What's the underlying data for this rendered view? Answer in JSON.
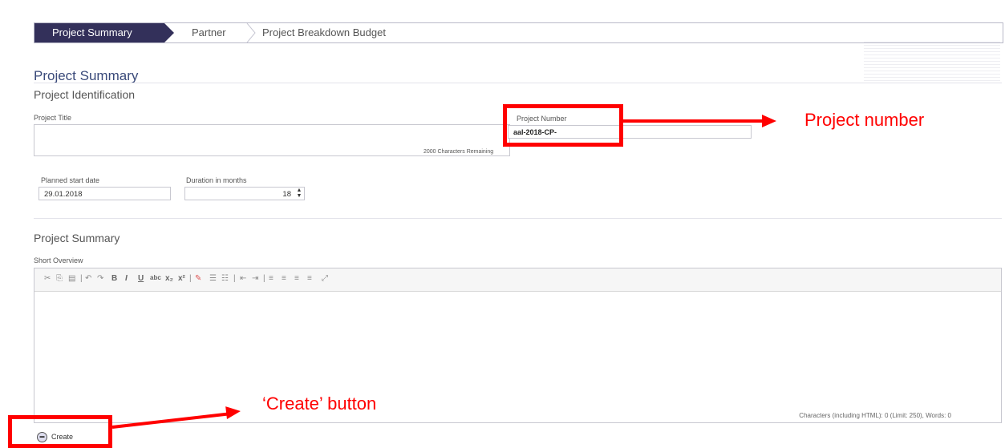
{
  "wizard": {
    "steps": [
      "Project Summary",
      "Partner",
      "Project Breakdown Budget"
    ]
  },
  "section": {
    "title": "Project Summary",
    "subtitle": "Project Identification"
  },
  "form": {
    "project_title_label": "Project Title",
    "project_title_value": "",
    "chars_remaining": "2000 Characters Remaining",
    "project_number_label": "Project Number",
    "project_number_value": "aal-2018-CP-",
    "start_date_label": "Planned start date",
    "start_date_value": "29.01.2018",
    "duration_label": "Duration in months",
    "duration_value": "18"
  },
  "summary": {
    "title": "Project Summary",
    "short_overview_label": "Short Overview",
    "char_count": "Characters (including HTML): 0 (Limit: 250), Words: 0"
  },
  "toolbar": {
    "buttons": [
      "cut-icon",
      "copy-icon",
      "paste-text-icon",
      "undo-icon",
      "redo-icon",
      "bold-icon",
      "italic-icon",
      "underline-icon",
      "strikethrough-icon",
      "subscript-icon",
      "superscript-icon",
      "remove-format-icon",
      "numbered-list-icon",
      "bulleted-list-icon",
      "outdent-icon",
      "indent-icon",
      "align-left-icon",
      "align-center-icon",
      "align-right-icon",
      "justify-icon",
      "maximize-icon"
    ]
  },
  "actions": {
    "create_label": "Create"
  },
  "annotations": {
    "project_number": "Project number",
    "create_button": "‘Create’ button"
  },
  "colors": {
    "active_step": "#33305a",
    "heading": "#3a4a7a",
    "annotation": "#ff0000"
  }
}
